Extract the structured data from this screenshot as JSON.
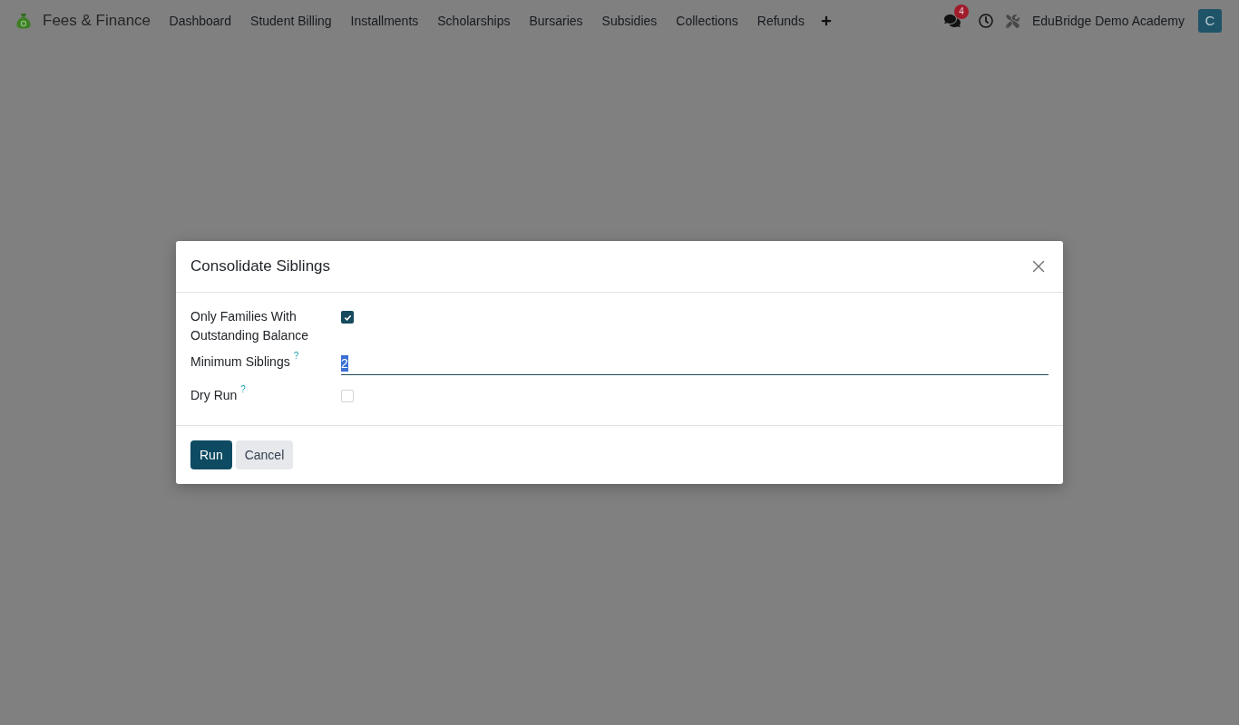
{
  "navbar": {
    "app_name": "Fees & Finance",
    "menu_items": [
      "Dashboard",
      "Student Billing",
      "Installments",
      "Scholarships",
      "Bursaries",
      "Subsidies",
      "Collections",
      "Refunds"
    ],
    "notifications": {
      "count": "4"
    },
    "company": "EduBridge Demo Academy",
    "avatar": {
      "initial": "C"
    }
  },
  "dialog": {
    "title": "Consolidate Siblings",
    "fields": [
      {
        "kind": "checkbox",
        "label": "Only Families With Outstanding Balance",
        "checked": true
      },
      {
        "kind": "number",
        "label": "Minimum Siblings",
        "help_mark": "?",
        "value": "2",
        "highlighted": true
      },
      {
        "kind": "checkbox",
        "label": "Dry Run",
        "help_mark": "?",
        "checked": false
      }
    ],
    "buttons": [
      {
        "label": "Run",
        "kind": "primary"
      },
      {
        "label": "Cancel",
        "kind": "secondary"
      }
    ]
  }
}
